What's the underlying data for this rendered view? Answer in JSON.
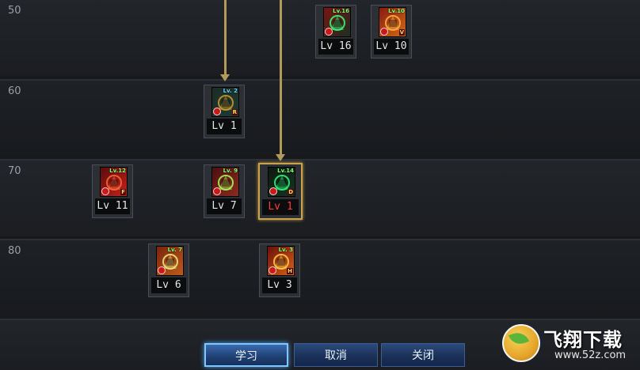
{
  "level_rows": [
    {
      "label": "50"
    },
    {
      "label": "60"
    },
    {
      "label": "70"
    },
    {
      "label": "80"
    }
  ],
  "skills": [
    {
      "name": "skill-a",
      "tag": "Lv.16",
      "level": "Lv 16",
      "letter": "",
      "tag_color": "#7cff6a",
      "bg": [
        "#7a1512",
        "#1b2e22"
      ],
      "accent": "#37ff7a",
      "selected": false,
      "red": false
    },
    {
      "name": "skill-b",
      "tag": "Lv.10",
      "level": "Lv 10",
      "letter": "V",
      "tag_color": "#7cff6a",
      "bg": [
        "#8a1a10",
        "#d26b18"
      ],
      "accent": "#ffb347",
      "selected": false,
      "red": false
    },
    {
      "name": "skill-c",
      "tag": "Lv. 2",
      "level": "Lv 1",
      "letter": "R",
      "tag_color": "#6ad2ff",
      "bg": [
        "#1d2c25",
        "#1c3c34"
      ],
      "accent": "#d49a2a",
      "selected": false,
      "red": false
    },
    {
      "name": "skill-d",
      "tag": "Lv.12",
      "level": "Lv 11",
      "letter": "F",
      "tag_color": "#7cff6a",
      "bg": [
        "#5c0c0c",
        "#c4221b"
      ],
      "accent": "#ff6a3a",
      "selected": false,
      "red": false
    },
    {
      "name": "skill-e",
      "tag": "Lv. 9",
      "level": "Lv 7",
      "letter": "",
      "tag_color": "#7cff6a",
      "bg": [
        "#4a1010",
        "#8c2a1e"
      ],
      "accent": "#a8ff5a",
      "selected": false,
      "red": false
    },
    {
      "name": "skill-f",
      "tag": "Lv.14",
      "level": "Lv 1",
      "letter": "D",
      "tag_color": "#7cff6a",
      "bg": [
        "#0d1a12",
        "#163322"
      ],
      "accent": "#2dff7a",
      "selected": true,
      "red": true
    },
    {
      "name": "skill-g",
      "tag": "Lv. 7",
      "level": "Lv 6",
      "letter": "",
      "tag_color": "#7cff6a",
      "bg": [
        "#7a2410",
        "#c05a1a"
      ],
      "accent": "#e8f080",
      "selected": false,
      "red": false
    },
    {
      "name": "skill-h",
      "tag": "Lv. 3",
      "level": "Lv 3",
      "letter": "H",
      "tag_color": "#7cff6a",
      "bg": [
        "#6a1008",
        "#d8601a"
      ],
      "accent": "#ffd04a",
      "selected": false,
      "red": false
    }
  ],
  "buttons": {
    "learn": "学习",
    "cancel": "取消",
    "close": "关闭"
  },
  "watermark": {
    "title": "飞翔下载",
    "site": "www.52z.com"
  }
}
